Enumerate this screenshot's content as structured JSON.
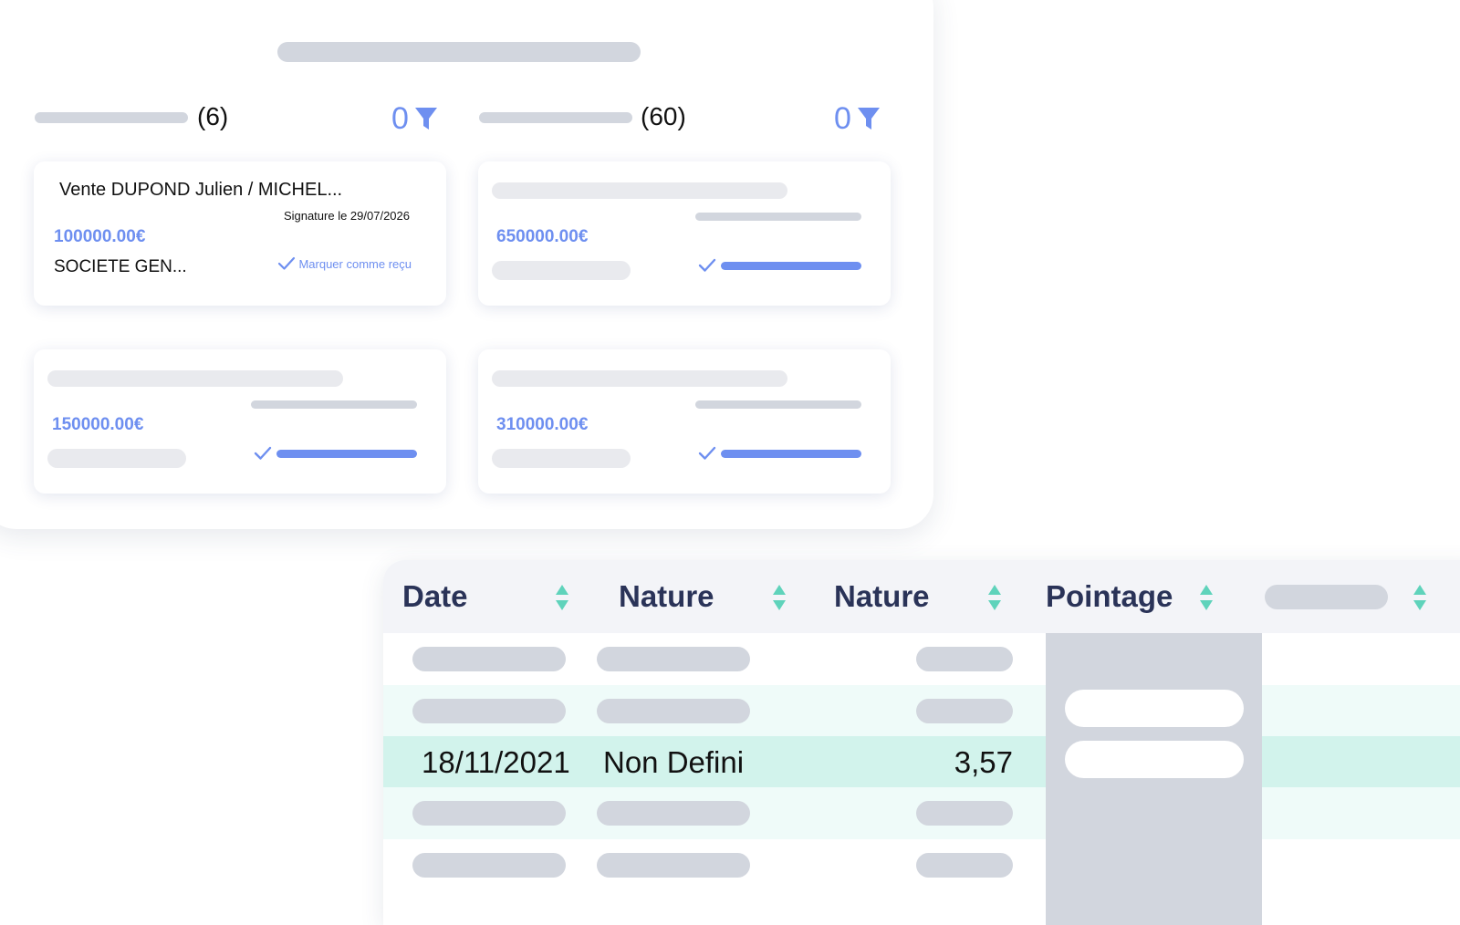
{
  "pending_column": {
    "count": "(6)",
    "filter_count": "0"
  },
  "received_column": {
    "count": "(60)",
    "filter_count": "0"
  },
  "cards": [
    {
      "title": "Vente DUPOND Julien / MICHEL...",
      "signature": "Signature le 29/07/2026",
      "amount": "100000.00€",
      "bank": "SOCIETE GEN...",
      "action": "Marquer comme reçu"
    },
    {
      "amount": "650000.00€"
    },
    {
      "amount": "150000.00€"
    },
    {
      "amount": "310000.00€"
    }
  ],
  "table": {
    "headers": [
      "Date",
      "Nature",
      "Nature",
      "Pointage"
    ],
    "highlighted_row": {
      "date": "18/11/2021",
      "nature": "Non Defini",
      "amount": "3,57"
    }
  },
  "colors": {
    "accent": "#6e8ff0",
    "sort_icon": "#5fd3bb",
    "row_tint": "#effbf9",
    "row_highlight": "#d2f3ec",
    "header_text": "#2a3358",
    "placeholder": "#d2d6de"
  },
  "icons": {
    "filter": "filter-funnel-icon",
    "check": "checkmark-icon",
    "sort": "sort-up-down-icon"
  }
}
